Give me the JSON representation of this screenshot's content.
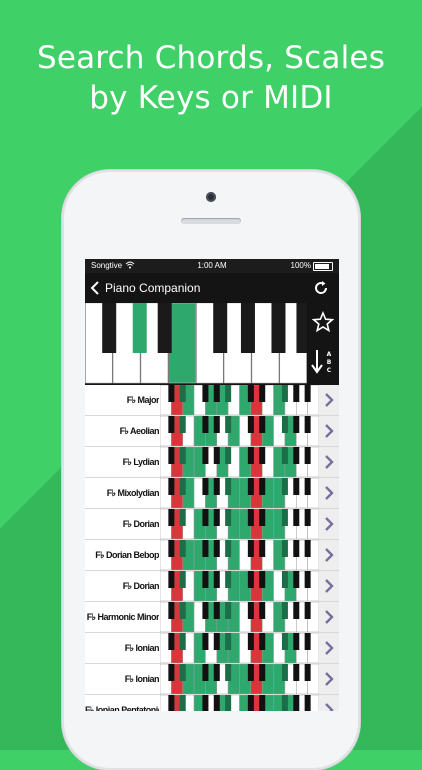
{
  "headline": [
    "Search Chords, Scales",
    "by Keys or MIDI"
  ],
  "status_bar": {
    "carrier": "Songtive",
    "time": "1:00 AM",
    "battery": "100%"
  },
  "nav": {
    "title": "Piano Companion",
    "back_icon": "chevron-left-icon",
    "refresh_icon": "refresh-icon"
  },
  "toolbar": {
    "favorite_icon": "star-icon",
    "sort_icon": "sort-abc-icon"
  },
  "colors": {
    "background": "#3fd068",
    "key_highlight": "#2fa86e",
    "key_root": "#d9353a",
    "arrow": "#7a6f9c"
  },
  "scales": [
    {
      "label": "F♭ Major"
    },
    {
      "label": "F♭ Aeolian"
    },
    {
      "label": "F♭ Lydian"
    },
    {
      "label": "F♭ Mixolydian"
    },
    {
      "label": "F♭ Dorian"
    },
    {
      "label": "F♭ Dorian Bebop"
    },
    {
      "label": "F♭ Dorian"
    },
    {
      "label": "F♭ Harmonic Minor"
    },
    {
      "label": "F♭ Ionian"
    },
    {
      "label": "F♭ Ionian"
    },
    {
      "label": "F♭ Ionian Pentatonic"
    }
  ]
}
